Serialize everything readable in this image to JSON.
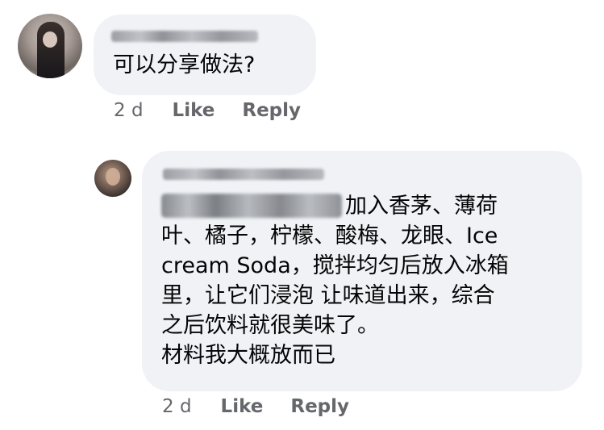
{
  "comments": [
    {
      "text": "可以分享做法?",
      "time": "2 d",
      "like_label": "Like",
      "reply_label": "Reply"
    },
    {
      "lines": [
        "加入香茅、薄荷",
        "叶、橘子，柠檬、酸梅、龙眼、Ice",
        "cream Soda，搅拌均匀后放入冰箱",
        "里，让它们浸泡 让味道出来，综合",
        "之后饮料就很美味了。",
        "材料我大概放而已"
      ],
      "time": "2 d",
      "like_label": "Like",
      "reply_label": "Reply"
    }
  ],
  "colors": {
    "bubble": "#f0f2f5",
    "text": "#050505",
    "meta": "#65676b"
  }
}
